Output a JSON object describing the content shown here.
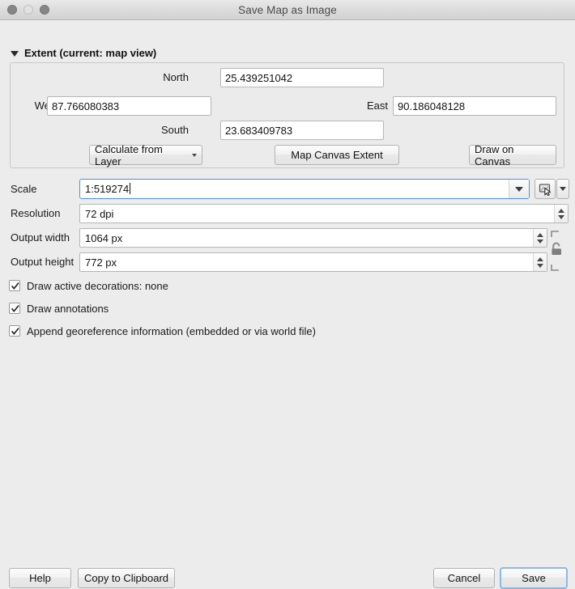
{
  "window": {
    "title": "Save Map as Image",
    "controls": [
      "close",
      "minimize",
      "zoom"
    ]
  },
  "extent_group": {
    "title": "Extent (current: map view)",
    "disclosure_state": "expanded",
    "fields": {
      "north": {
        "label": "North",
        "value": "25.439251042"
      },
      "west": {
        "label": "West",
        "value": "87.766080383"
      },
      "east": {
        "label": "East",
        "value": "90.186048128"
      },
      "south": {
        "label": "South",
        "value": "23.683409783"
      }
    },
    "buttons": {
      "calculate_from_layer": "Calculate from Layer",
      "map_canvas_extent": "Map Canvas Extent",
      "draw_on_canvas": "Draw on Canvas"
    }
  },
  "settings": {
    "scale": {
      "label": "Scale",
      "value": "1:519274",
      "focused": true,
      "tool_icon": "map-canvas-scale-icon",
      "tool_menu_icon": "chevron-down-icon"
    },
    "resolution": {
      "label": "Resolution",
      "value": "72 dpi"
    },
    "output_width": {
      "label": "Output width",
      "value": "1064 px"
    },
    "output_height": {
      "label": "Output height",
      "value": "772 px"
    },
    "aspect_lock": {
      "icon": "unlocked-padlock-icon",
      "state": "unlocked"
    }
  },
  "options": [
    {
      "label": "Draw active decorations: none",
      "checked": true
    },
    {
      "label": "Draw annotations",
      "checked": true
    },
    {
      "label": "Append georeference information (embedded or via world file)",
      "checked": true
    }
  ],
  "footer": {
    "help": "Help",
    "copy_to_clipboard": "Copy to Clipboard",
    "cancel": "Cancel",
    "save": "Save",
    "default_button": "Save"
  },
  "colors": {
    "window_bg": "#ececec",
    "group_bg": "#ebebeb",
    "field_bg": "#ffffff",
    "focus_blue": "#4a90e2",
    "default_btn_border": "#8cb8e8",
    "text": "#1a1a1a"
  }
}
